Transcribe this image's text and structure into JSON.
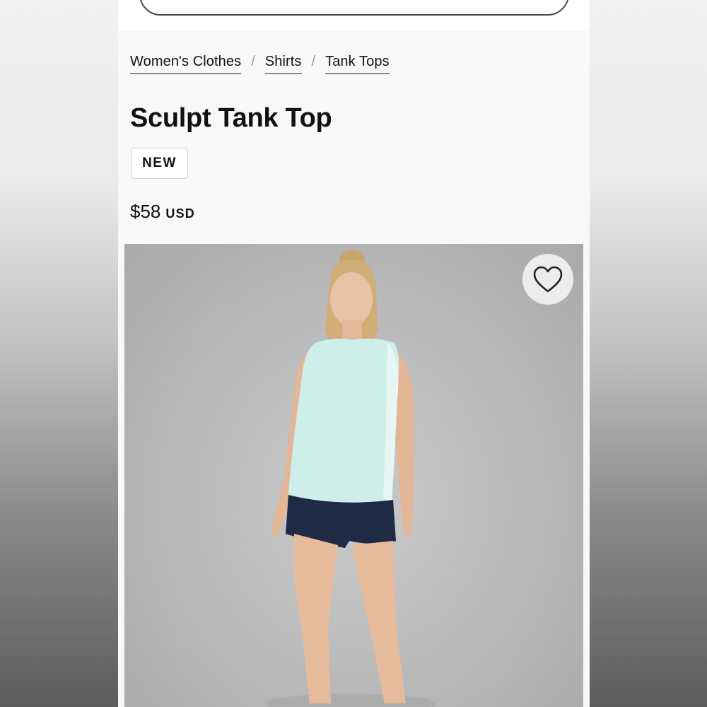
{
  "breadcrumb": {
    "items": [
      {
        "label": "Women's Clothes"
      },
      {
        "label": "Shirts"
      },
      {
        "label": "Tank Tops"
      }
    ],
    "separator": "/"
  },
  "product": {
    "title": "Sculpt Tank Top",
    "badge": "NEW",
    "price": "$58",
    "currency": "USD"
  },
  "icons": {
    "wishlist": "heart-outline-icon"
  },
  "colors": {
    "page_bg": "#f8f8f8",
    "text": "#111111",
    "tank_top": "#cdeee9",
    "shorts": "#1f2a44"
  }
}
